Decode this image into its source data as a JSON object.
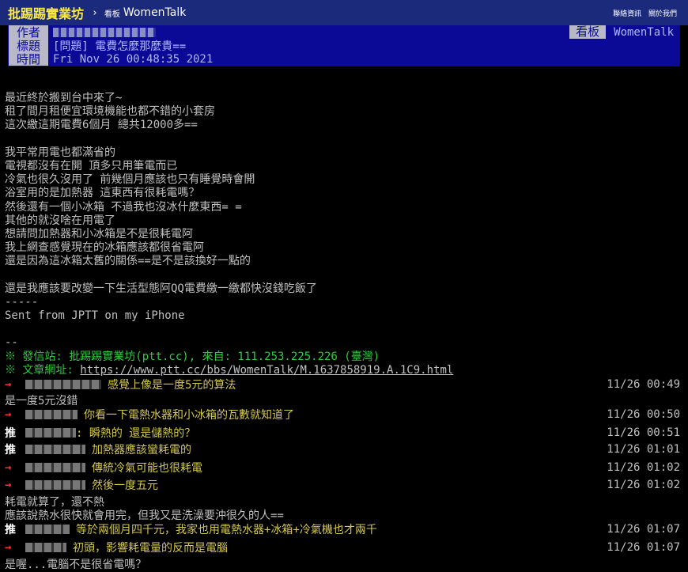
{
  "topbar": {
    "site_name": "批踢踢實業坊",
    "sep": "›",
    "board_tag": "看板",
    "board": "WomenTalk",
    "links": [
      "聯絡資訊",
      "關於我們"
    ]
  },
  "meta": {
    "author_key": "作者",
    "title_key": "標題",
    "time_key": "時間",
    "title": "[問題] 電費怎麼那麼貴==",
    "time": "Fri Nov 26 00:48:35 2021",
    "board_key": "看板",
    "board": "WomenTalk"
  },
  "body": [
    "最近終於搬到台中來了~",
    "租了間月租便宜環境機能也都不錯的小套房",
    "這次繳這期電費6個月 總共12000多==",
    "",
    "我平常用電也都滿省的",
    "電視都沒有在開 頂多只用筆電而已",
    "冷氣也很久沒用了 前幾個月應該也只有睡覺時會開",
    "浴室用的是加熱器 這東西有很耗電嗎？",
    "然後還有一個小冰箱 不過我也沒冰什麼東西= =",
    "其他的就沒啥在用電了",
    "想請問加熱器和小冰箱是不是很耗電阿",
    "我上網查感覺現在的冰箱應該都很省電阿",
    "還是因為這冰箱太舊的關係==是不是該換好一點的",
    "",
    "還是我應該要改變一下生活型態阿QQ電費繳一繳都快沒錢吃飯了",
    "-----",
    "Sent from JPTT on my iPhone",
    "",
    "--"
  ],
  "footer": {
    "from_line": "※ 發信站: 批踢踢實業坊(ptt.cc), 來自: 111.253.225.226 (臺灣)",
    "url_prefix": "※ 文章網址: ",
    "url": "https://www.ptt.cc/bbs/WomenTalk/M.1637858919.A.1C9.html"
  },
  "pushes": [
    {
      "tag": "→",
      "content": "感覺上像是一度5元的算法",
      "time": "11/26 00:49"
    },
    {
      "tag": "→",
      "content": "你看一下電熱水器和小冰箱的瓦數就知道了",
      "time": "11/26 00:50"
    },
    {
      "tag": "推",
      "content": ": 瞬熱的 還是儲熱的？",
      "time": "11/26 00:51"
    },
    {
      "tag": "推",
      "content": "加熱器應該蠻耗電的",
      "time": "11/26 01:01"
    },
    {
      "tag": "→",
      "content": "傳統冷氣可能也很耗電",
      "time": "11/26 01:02"
    },
    {
      "tag": "→",
      "content": "然後一度五元",
      "time": "11/26 01:02"
    },
    {
      "tag": "推",
      "content": "等於兩個月四千元，我家也用電熱水器+冰箱+冷氣機也才兩千",
      "time": "11/26 01:07"
    },
    {
      "tag": "→",
      "content": "初頭，影響耗電量的反而是電腦",
      "time": "11/26 01:07"
    }
  ],
  "replies": [
    "是一度5元沒錯",
    "耗電就算了，還不熱",
    "應該說熱水很快就會用完，但我又是洗澡要沖很久的人==",
    "是喔...電腦不是很省電嗎？"
  ]
}
